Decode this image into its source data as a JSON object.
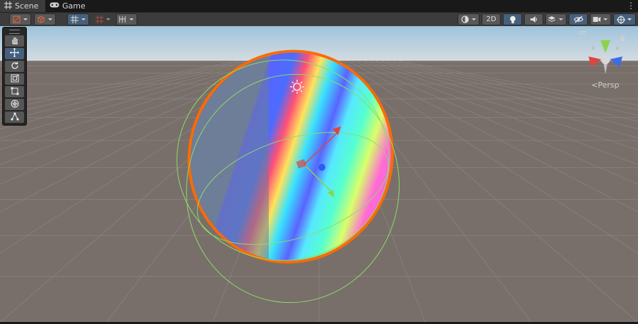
{
  "tabs": [
    {
      "label": "Scene",
      "icon": "hash-grid-icon",
      "active": true
    },
    {
      "label": "Game",
      "icon": "gamepad-icon",
      "active": false
    }
  ],
  "toolbar": {
    "mode_2d_label": "2D",
    "buttons": [
      "gizmo-draw-mode",
      "shading-mode",
      "grid-snap",
      "increment-snap",
      "grid-visibility",
      "render-mode",
      "2d-toggle",
      "lighting-toggle",
      "audio-toggle",
      "effects",
      "scene-visibility",
      "camera-settings",
      "gizmos"
    ]
  },
  "tools": [
    "view-tool",
    "move-tool",
    "rotate-tool",
    "scale-tool",
    "rect-tool",
    "transform-tool",
    "custom-tool"
  ],
  "active_tool": "move-tool",
  "viewport": {
    "projection_label": "Persp",
    "projection_prefix": "<",
    "colors": {
      "sky_top": "#9fc3dc",
      "sky_horizon": "#c9d6dd",
      "ground": "#786f6a",
      "selection_outline": "#ff6a00",
      "collider": "#8ddc6a",
      "axis_x": "#e0443e",
      "axis_y": "#8cd34a",
      "axis_z": "#3a6ee8"
    }
  }
}
